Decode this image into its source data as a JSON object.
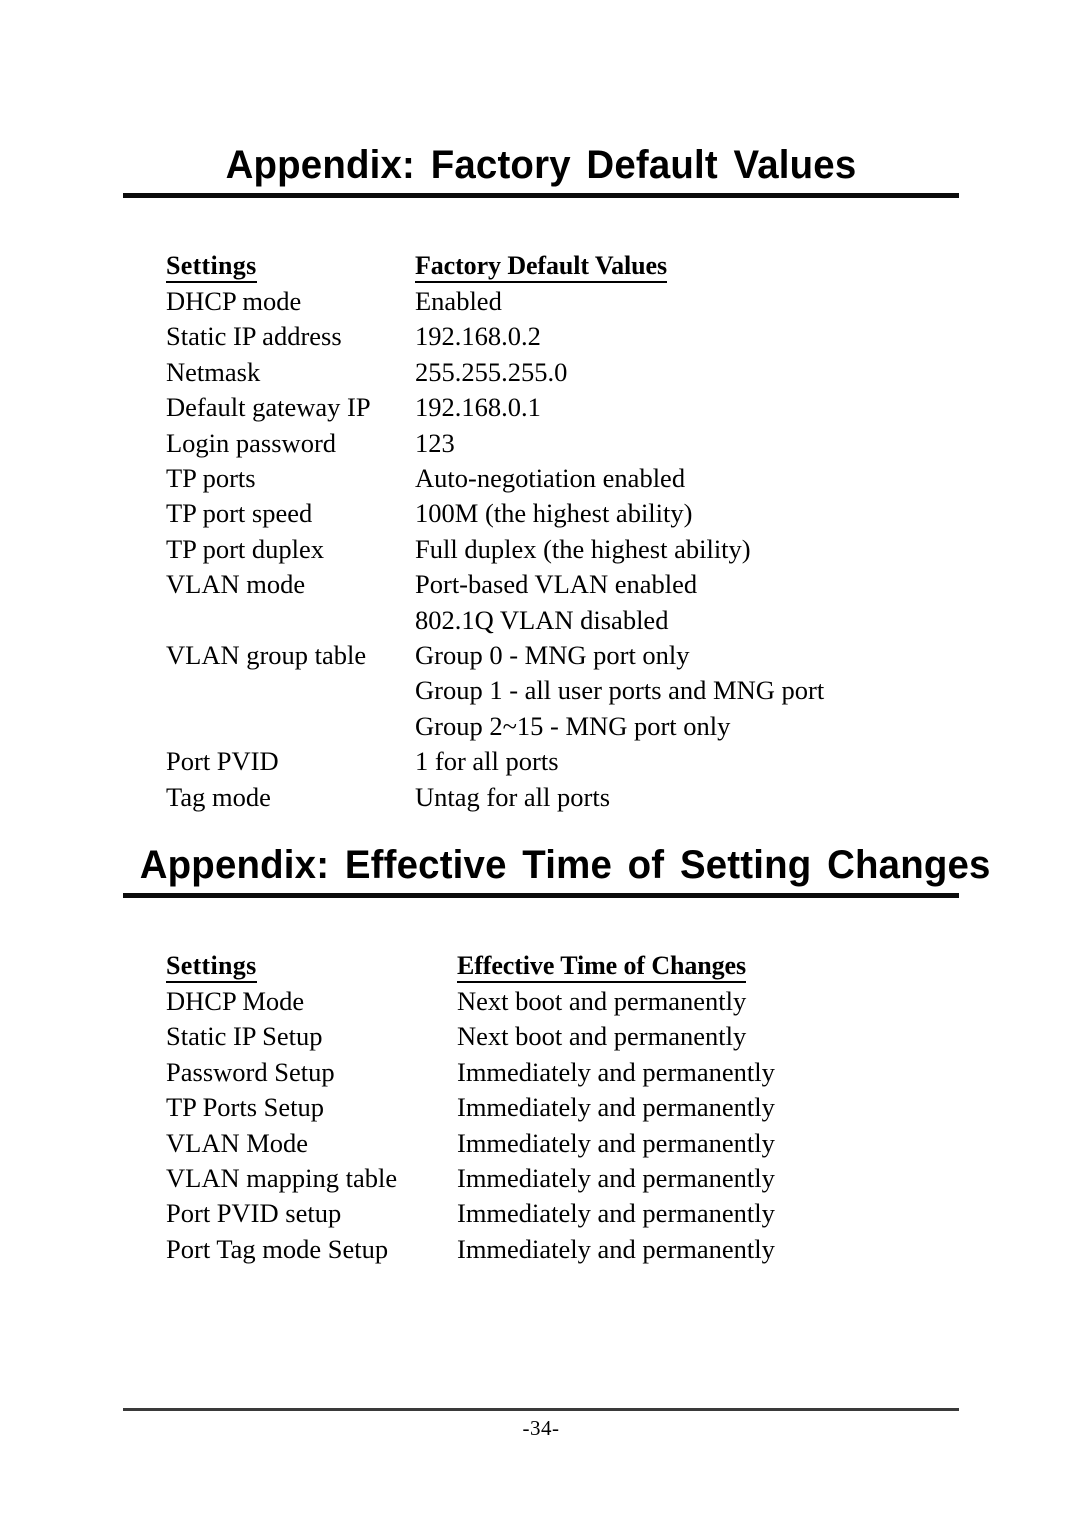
{
  "document": {
    "page_number_label": "-34-"
  },
  "sections": [
    {
      "heading": "Appendix: Factory Default Values",
      "table": {
        "headers": {
          "setting": "Settings",
          "value": "Factory Default Values"
        },
        "rows": [
          {
            "setting": "DHCP  mode",
            "value": "Enabled",
            "extra": []
          },
          {
            "setting": "Static IP address",
            "value": "192.168.0.2",
            "extra": []
          },
          {
            "setting": "Netmask",
            "value": "255.255.255.0",
            "extra": []
          },
          {
            "setting": "Default gateway IP",
            "value": "192.168.0.1",
            "extra": []
          },
          {
            "setting": "Login password",
            "value": "123",
            "extra": []
          },
          {
            "setting": "TP ports",
            "value": "Auto-negotiation  enabled",
            "extra": []
          },
          {
            "setting": "TP port speed",
            "value": "100M (the highest ability)",
            "extra": []
          },
          {
            "setting": "TP port duplex",
            "value": "Full duplex (the highest ability)",
            "extra": []
          },
          {
            "setting": "VLAN mode",
            "value": "Port-based VLAN enabled",
            "extra": [
              "802.1Q VLAN disabled"
            ]
          },
          {
            "setting": "VLAN group table",
            "value": "Group 0 - MNG port only",
            "extra": [
              "Group 1 - all user ports and MNG port",
              "Group 2~15 - MNG port only"
            ]
          },
          {
            "setting": "Port PVID",
            "value": "1 for all ports",
            "extra": []
          },
          {
            "setting": "Tag mode",
            "value": "Untag for all ports",
            "extra": []
          }
        ]
      }
    },
    {
      "heading": "Appendix: Effective Time of Setting Changes",
      "table": {
        "headers": {
          "setting": "Settings",
          "value": "Effective Time of Changes"
        },
        "rows": [
          {
            "setting": "DHCP Mode",
            "value": "Next boot and permanently",
            "extra": []
          },
          {
            "setting": "Static IP Setup",
            "value": "Next boot and permanently",
            "extra": []
          },
          {
            "setting": "Password  Setup",
            "value": "Immediately and permanently",
            "extra": []
          },
          {
            "setting": "TP Ports Setup",
            "value": "Immediately and permanently",
            "extra": []
          },
          {
            "setting": "VLAN Mode",
            "value": "Immediately and permanently",
            "extra": []
          },
          {
            "setting": "VLAN mapping table",
            "value": "Immediately and permanently",
            "extra": []
          },
          {
            "setting": "Port PVID setup",
            "value": "Immediately and permanently",
            "extra": []
          },
          {
            "setting": "Port Tag mode Setup",
            "value": "Immediately and permanently",
            "extra": []
          }
        ]
      }
    }
  ]
}
